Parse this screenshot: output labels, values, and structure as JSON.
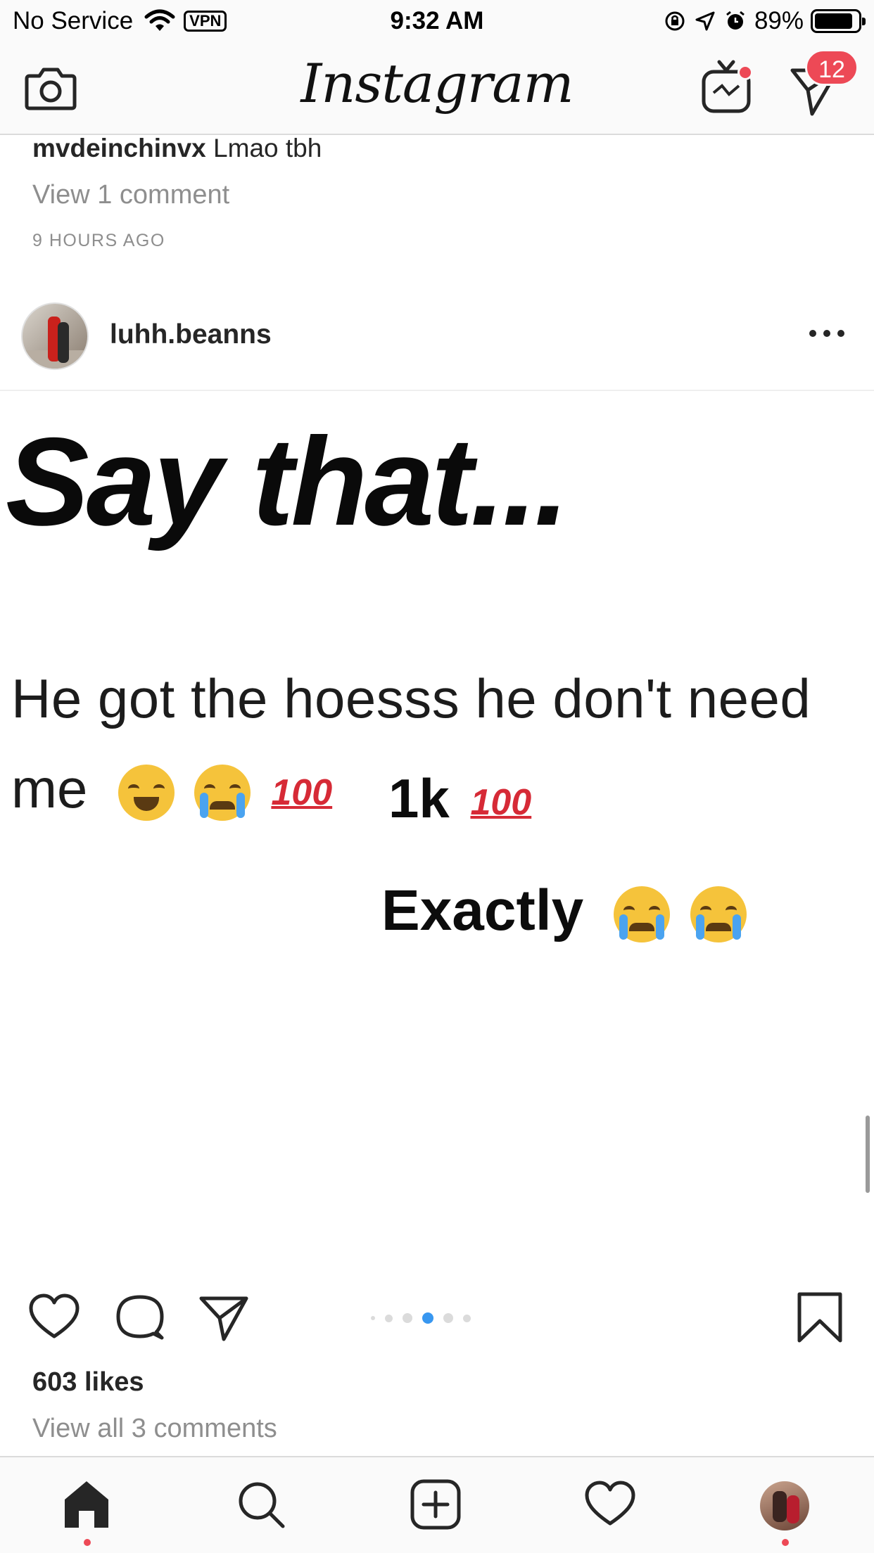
{
  "status_bar": {
    "carrier": "No Service",
    "vpn": "VPN",
    "time": "9:32 AM",
    "battery": "89%",
    "battery_level": 0.89
  },
  "top_nav": {
    "logo": "Instagram",
    "dm_badge": "12",
    "icons": [
      "camera-icon",
      "igtv-icon",
      "direct-message-icon"
    ]
  },
  "previous_post": {
    "comment_user": "mvdeinchinvx",
    "comment_text": " Lmao tbh",
    "view_comments": "View 1 comment",
    "time": "9 HOURS AGO"
  },
  "post": {
    "username": "luhh.beanns",
    "image": {
      "headline": "Say that...",
      "line1": "He got the hoesss he don't need",
      "line2": "me",
      "hundred": "100",
      "reply1": "1k",
      "reply2": "Exactly"
    },
    "carousel": {
      "count": 6,
      "active_index": 3
    },
    "likes": "603 likes",
    "view_all": "View all 3 comments"
  },
  "tab_bar": {
    "icons": [
      "home-icon",
      "search-icon",
      "new-post-icon",
      "activity-heart-icon",
      "profile-avatar"
    ]
  },
  "colors": {
    "badge_red": "#ed4956",
    "active_blue": "#3897f0",
    "secondary_text": "#8e8e8e"
  }
}
